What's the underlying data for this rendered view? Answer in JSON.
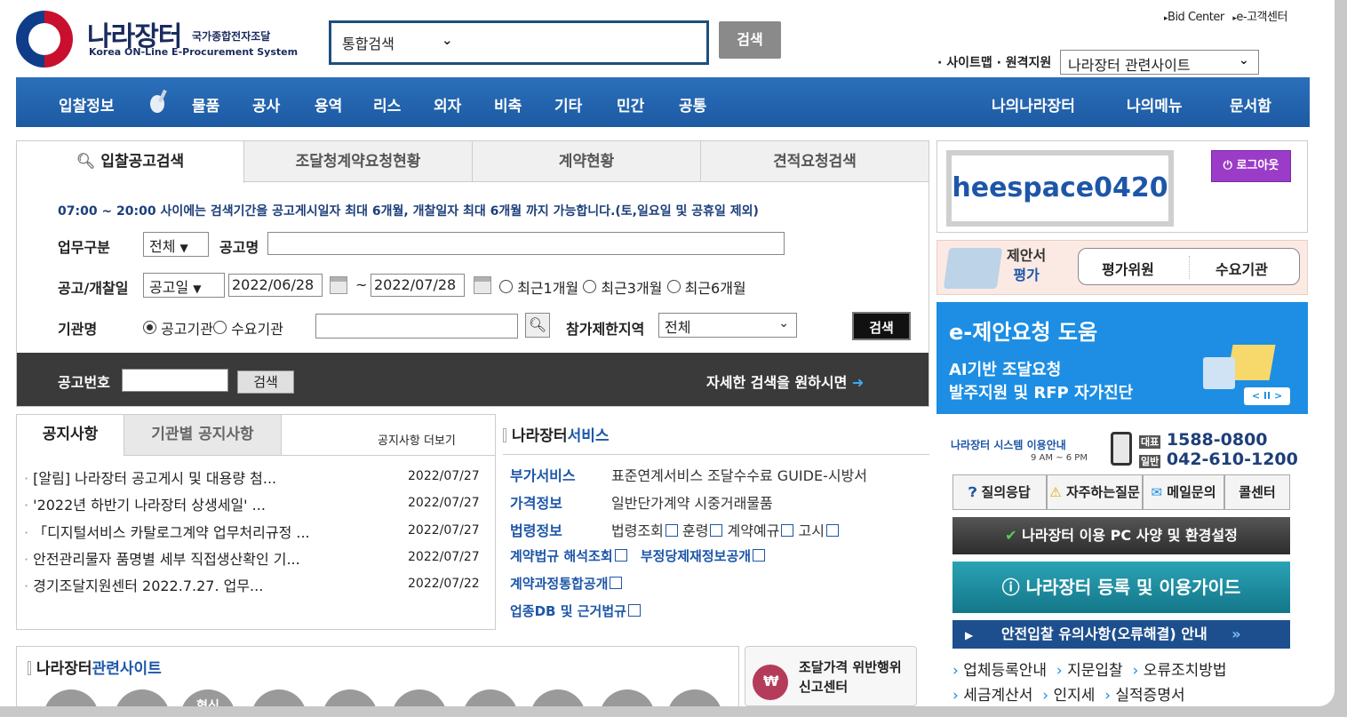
{
  "header": {
    "logo_title": "나라장터",
    "logo_sub_kr": "국가종합전자조달",
    "logo_sub_en": "Korea ON-Line E-Procurement System",
    "search_scope": "통합검색",
    "search_button": "검색",
    "top_links": [
      "Bid Center",
      "e-고객센터"
    ],
    "sitemap": "· 사이트맵 · 원격지원",
    "related_sites_select": "나라장터 관련사이트"
  },
  "nav": {
    "left": [
      "입찰정보",
      "물품",
      "공사",
      "용역",
      "리스",
      "외자",
      "비축",
      "기타",
      "민간",
      "공통"
    ],
    "right": [
      "나의나라장터",
      "나의메뉴",
      "문서함"
    ]
  },
  "search_panel": {
    "tabs": [
      "입찰공고검색",
      "조달청계약요청현황",
      "계약현황",
      "견적요청검색"
    ],
    "notice": "07:00 ~ 20:00 사이에는 검색기간을 공고게시일자 최대 6개월, 개찰일자 최대 6개월 까지 가능합니다.(토,일요일 및 공휴일 제외)",
    "work_type_label": "업무구분",
    "work_type_value": "전체",
    "notice_name_label": "공고명",
    "date_label": "공고/개찰일",
    "date_type_value": "공고일",
    "date_from": "2022/06/28",
    "date_to": "2022/07/28",
    "date_sep": "~",
    "period_options": [
      "최근1개월",
      "최근3개월",
      "최근6개월"
    ],
    "org_label": "기관명",
    "org_options": [
      "공고기관",
      "수요기관"
    ],
    "region_label": "참가제한지역",
    "region_value": "전체",
    "search_button": "검색",
    "bid_no_label": "공고번호",
    "bid_no_button": "검색",
    "detail_link": "자세한 검색을 원하시면"
  },
  "notices": {
    "tabs": [
      "공지사항",
      "기관별 공지사항"
    ],
    "more": "공지사항 더보기",
    "items": [
      {
        "title": "[알림] 나라장터 공고게시 및 대용량 첨...",
        "date": "2022/07/27"
      },
      {
        "title": "'2022년 하반기 나라장터 상생세일' ...",
        "date": "2022/07/27"
      },
      {
        "title": "「디지털서비스 카탈로그계약 업무처리규정 ...",
        "date": "2022/07/27"
      },
      {
        "title": "안전관리물자 품명별 세부 직접생산확인 기...",
        "date": "2022/07/27"
      },
      {
        "title": "경기조달지원센터 2022.7.27. 업무...",
        "date": "2022/07/22"
      }
    ]
  },
  "services": {
    "title_a": "나라장터",
    "title_b": "서비스",
    "rows": [
      {
        "key": "부가서비스",
        "value": "표준연계서비스 조달수수료 GUIDE-시방서"
      },
      {
        "key": "가격정보",
        "value": "일반단가계약 시중거래물품"
      }
    ],
    "law_key": "법령정보",
    "law_items": [
      "법령조회",
      "훈령",
      "계약예규",
      "고시"
    ],
    "extra_links": [
      "계약법규 해석조회",
      "부정당제재정보공개",
      "계약과정통합공개",
      "업종DB 및 근거법규"
    ]
  },
  "related": {
    "title_a": "나라장터",
    "title_b": "관련사이트",
    "icon_label": "혁신"
  },
  "report": {
    "line1": "조달가격 위반행위",
    "line2": "신고센터"
  },
  "login": {
    "user_id": "heespace0420",
    "logout": "로그아웃"
  },
  "eval": {
    "label1": "제안서",
    "label2": "평가",
    "btn1": "평가위원",
    "btn2": "수요기관"
  },
  "banner": {
    "title": "e-제안요청 도움",
    "line1": "AI기반 조달요청",
    "line2": "발주지원 및 RFP 자가진단"
  },
  "help": {
    "guide_title": "나라장터 시스템 이용안내",
    "hours": "9 AM ~ 6 PM",
    "rep_label": "대표",
    "rep_phone": "1588-0800",
    "gen_label": "일반",
    "gen_phone": "042-610-1200",
    "buttons": [
      "질의응답",
      "자주하는질문",
      "메일문의",
      "콜센터"
    ],
    "pc_spec": "나라장터 이용 PC 사양 및 환경설정",
    "guide": "나라장터 등록 및 이용가이드",
    "safe_bid": "안전입찰 유의사항(오류해결) 안내",
    "links_row1": [
      "업체등록안내",
      "지문입찰",
      "오류조치방법"
    ],
    "links_row2": [
      "세금계산서",
      "인지세",
      "실적증명서"
    ]
  },
  "colors": {
    "nav_blue": "#1d5aa3",
    "accent_purple": "#9b3cc8",
    "teal": "#137789",
    "banner_blue": "#1d8ee3"
  }
}
